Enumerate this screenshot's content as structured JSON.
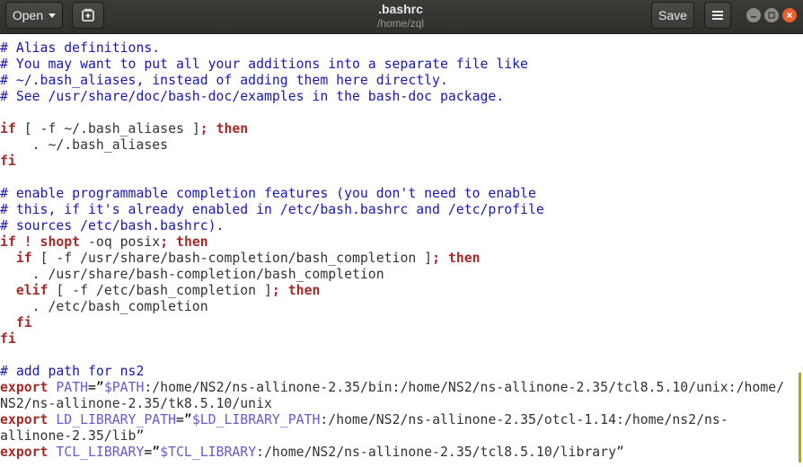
{
  "header": {
    "open_label": "Open",
    "title": ".bashrc",
    "subtitle": "/home/zql",
    "save_label": "Save"
  },
  "icons": {
    "new_tab": "new-document-icon",
    "menu": "hamburger-menu-icon",
    "minimize": "minimize-icon",
    "maximize": "maximize-icon",
    "close": "close-icon"
  },
  "colors": {
    "comment": "#1818b2",
    "keyword": "#a52a2a",
    "variable": "#6a5acd",
    "titlebar": "#3b3a37",
    "close_button": "#e8602d"
  },
  "code": {
    "l1": "# Alias definitions.",
    "l2": "# You may want to put all your additions into a separate file like",
    "l3": "# ~/.bash_aliases, instead of adding them here directly.",
    "l4": "# See /usr/share/doc/bash-doc/examples in the bash-doc package.",
    "l6_kw1": "if",
    "l6_a": " [ -f ~/.bash_aliases ]",
    "l6_semi": ";",
    "l6_kw2": "then",
    "l7": "    . ~/.bash_aliases",
    "l8": "fi",
    "l10": "# enable programmable completion features (you don't need to enable",
    "l11": "# this, if it's already enabled in /etc/bash.bashrc and /etc/profile",
    "l12": "# sources /etc/bash.bashrc).",
    "l13_kw1": "if ! shopt",
    "l13_a": " -oq posix",
    "l13_semi": ";",
    "l13_kw2": "then",
    "l14_kw1": "if",
    "l14_a": " [ -f /usr/share/bash-completion/bash_completion ]",
    "l14_semi": ";",
    "l14_kw2": "then",
    "l15": "    . /usr/share/bash-completion/bash_completion",
    "l16_kw1": "elif",
    "l16_a": " [ -f /etc/bash_completion ]",
    "l16_semi": ";",
    "l16_kw2": "then",
    "l17": "    . /etc/bash_completion",
    "l18": "fi",
    "l19": "fi",
    "l21": "# add path for ns2",
    "l22_kw": "export",
    "l22_var": "PATH",
    "l22_eq": "=”",
    "l22_ref": "$PATH",
    "l22_rest": ":/home/NS2/ns-allinone-2.35/bin:/home/NS2/ns-allinone-2.35/tcl8.5.10/unix:/home/",
    "l23": "NS2/ns-allinone-2.35/tk8.5.10/unix",
    "l24_kw": "export",
    "l24_var": "LD_LIBRARY_PATH",
    "l24_eq": "=”",
    "l24_ref": "$LD_LIBRARY_PATH",
    "l24_rest": ":/home/NS2/ns-allinone-2.35/otcl-1.14:/home/ns2/ns-",
    "l25": "allinone-2.35/lib”",
    "l26_kw": "export",
    "l26_var": "TCL_LIBRARY",
    "l26_eq": "=”",
    "l26_ref": "$TCL_LIBRARY",
    "l26_rest": ":/home/NS2/ns-allinone-2.35/tcl8.5.10/library”"
  }
}
